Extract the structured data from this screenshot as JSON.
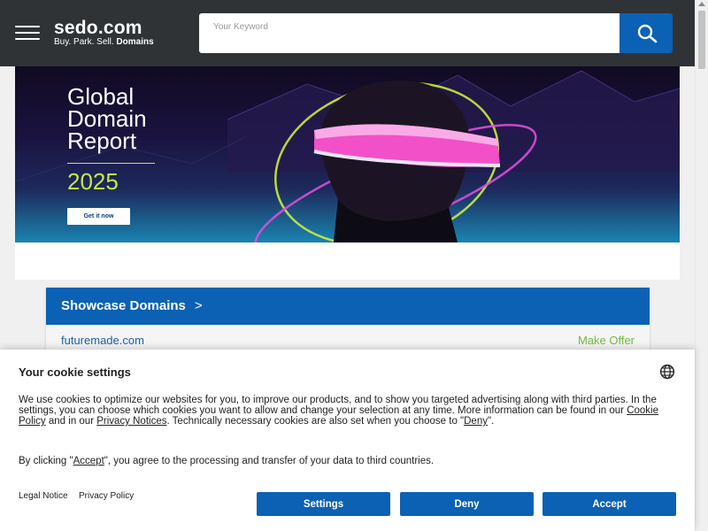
{
  "header": {
    "logo_main": "sedo.com",
    "logo_tag_prefix": "Buy. Park. Sell. ",
    "logo_tag_bold": "Domains",
    "search_placeholder": "Your Keyword"
  },
  "banner": {
    "title_line1": "Global",
    "title_line2": "Domain",
    "title_line3": "Report",
    "year": "2025",
    "cta": "Get it now"
  },
  "showcase": {
    "heading": "Showcase Domains",
    "chevron": ">",
    "domain": "futuremade.com",
    "action": "Make Offer"
  },
  "cookie": {
    "title": "Your cookie settings",
    "text_part1": "We use cookies to optimize our websites for you, to improve our products, and to show you targeted advertising along with third parties. In the settings, you can choose which cookies you want to allow and change your selection at any time. More information can be found in our ",
    "cookie_policy": "Cookie Policy",
    "text_part2": " and in our ",
    "privacy_notices": "Privacy Notices",
    "text_part3": ". Technically necessary cookies are also set when you choose to \"",
    "deny_link": "Deny",
    "text_part4": "\".",
    "accept_text_prefix": "By clicking \"",
    "accept_link": "Accept",
    "accept_text_suffix": "\", you agree to the processing and transfer of your data to third countries.",
    "legal_notice": "Legal Notice",
    "privacy_policy": "Privacy Policy",
    "btn_settings": "Settings",
    "btn_deny": "Deny",
    "btn_accept": "Accept"
  },
  "colors": {
    "header_bg": "#2f3336",
    "brand_blue": "#0b61b3",
    "accent_green": "#c5e84a",
    "offer_green": "#74b944"
  },
  "icons": {
    "search": "search-icon",
    "menu": "hamburger-menu-icon",
    "language": "globe-icon"
  }
}
